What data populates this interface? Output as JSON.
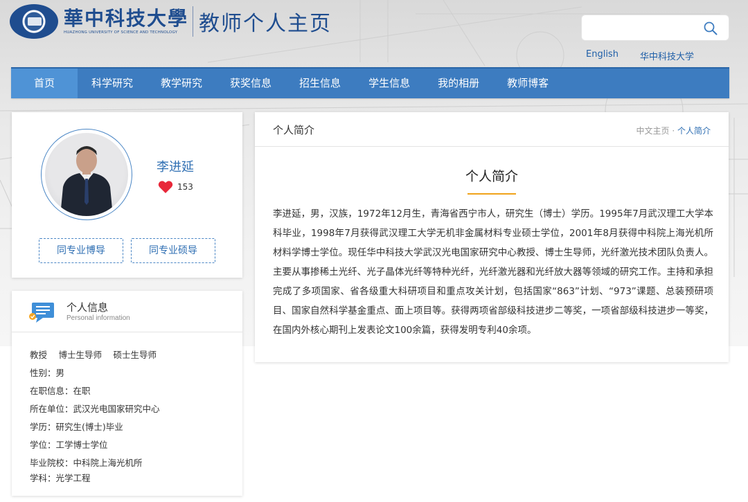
{
  "header": {
    "logo_cn": "華中科技大學",
    "logo_en": "HUAZHONG UNIVERSITY OF SCIENCE AND TECHNOLOGY",
    "site_title": "教师个人主页",
    "search_placeholder": "",
    "links": [
      "English",
      "华中科技大学"
    ]
  },
  "nav": {
    "items": [
      "首页",
      "科学研究",
      "教学研究",
      "获奖信息",
      "招生信息",
      "学生信息",
      "我的相册",
      "教师博客"
    ],
    "active_index": 0
  },
  "profile": {
    "name": "李进延",
    "likes": "153",
    "buttons": [
      "同专业博导",
      "同专业硕导"
    ]
  },
  "info": {
    "title": "个人信息",
    "subtitle": "Personal information",
    "rows": [
      "教授　 博士生导师　 硕士生导师",
      "性别：男",
      "在职信息：在职",
      "所在单位：武汉光电国家研究中心",
      "学历：研究生(博士)毕业",
      "学位：工学博士学位",
      "毕业院校：中科院上海光机所",
      "学科：光学工程"
    ]
  },
  "bio": {
    "section_title": "个人简介",
    "breadcrumb_home": "中文主页",
    "breadcrumb_sep": " · ",
    "breadcrumb_current": "个人简介",
    "heading": "个人简介",
    "text": "李进延，男，汉族，1972年12月生，青海省西宁市人，研究生（博士）学历。1995年7月武汉理工大学本科毕业，1998年7月获得武汉理工大学无机非金属材料专业硕士学位，2001年8月获得中科院上海光机所材料学博士学位。现任华中科技大学武汉光电国家研究中心教授、博士生导师，光纤激光技术团队负责人。主要从事掺稀土光纤、光子晶体光纤等特种光纤，光纤激光器和光纤放大器等领域的研究工作。主持和承担完成了多项国家、省各级重大科研项目和重点攻关计划，包括国家“863”计划、“973”课题、总装预研项目、国家自然科学基金重点、面上项目等。获得两项省部级科技进步二等奖，一项省部级科技进步一等奖，在国内外核心期刊上发表论文100余篇，获得发明专利40余项。"
  },
  "colors": {
    "nav_bg": "#3d7cc0",
    "nav_active": "#4f93d6",
    "accent_blue": "#2f6fb3",
    "underline_orange": "#f0a21a",
    "heart_red": "#e8283a"
  },
  "icons": [
    "search-icon",
    "heart-icon",
    "chat-info-icon"
  ]
}
